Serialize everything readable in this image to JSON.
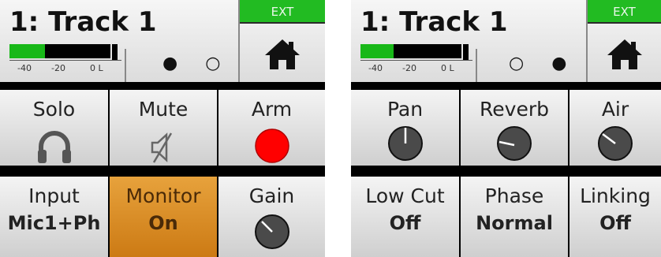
{
  "colors": {
    "meter_green": "#18b818",
    "ext_green": "#22bb22",
    "arm_red": "#ff0000",
    "monitor_orange": "#dc8c24"
  },
  "left": {
    "track_title": "1: Track 1",
    "meter": {
      "scale": [
        "-40",
        "-20",
        "0 L"
      ],
      "level_fraction": 0.35
    },
    "dots": "● ○",
    "ext_label": "EXT",
    "home_icon": "home-icon",
    "row1": [
      {
        "label": "Solo",
        "icon": "headphones-icon"
      },
      {
        "label": "Mute",
        "icon": "speaker-muted-icon"
      },
      {
        "label": "Arm",
        "icon": "record-circle-icon"
      }
    ],
    "row2": [
      {
        "label": "Input",
        "value": "Mic1+Ph"
      },
      {
        "label": "Monitor",
        "value": "On"
      },
      {
        "label": "Gain",
        "icon": "knob-icon"
      }
    ]
  },
  "right": {
    "track_title": "1: Track 1",
    "meter": {
      "scale": [
        "-40",
        "-20",
        "0 L"
      ],
      "level_fraction": 0.33
    },
    "dots": "○ ●",
    "ext_label": "EXT",
    "home_icon": "home-icon",
    "row1": [
      {
        "label": "Pan",
        "icon": "knob-icon"
      },
      {
        "label": "Reverb",
        "icon": "knob-icon"
      },
      {
        "label": "Air",
        "icon": "knob-icon"
      }
    ],
    "row2": [
      {
        "label": "Low Cut",
        "value": "Off"
      },
      {
        "label": "Phase",
        "value": "Normal"
      },
      {
        "label": "Linking",
        "value": "Off"
      }
    ]
  }
}
